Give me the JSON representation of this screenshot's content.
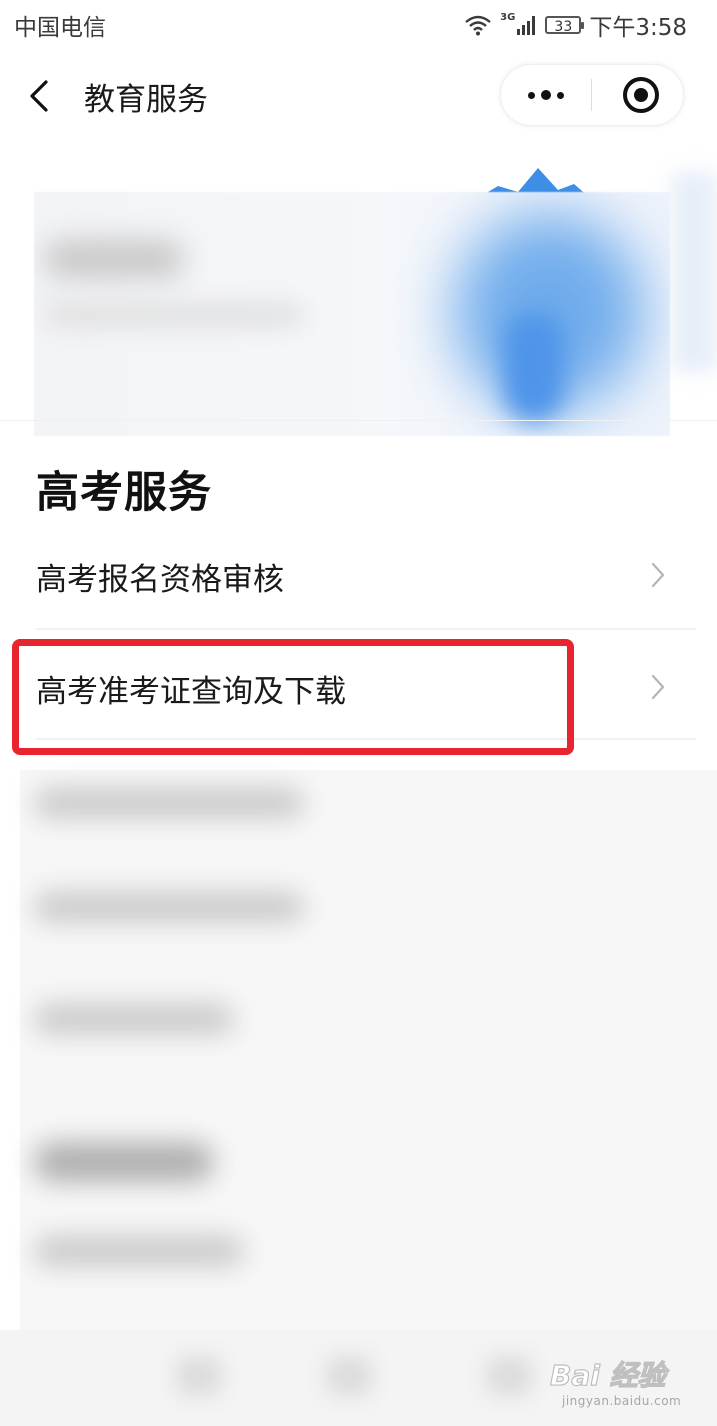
{
  "status_bar": {
    "carrier": "中国电信",
    "network": "3G",
    "battery": "33",
    "time": "下午3:58"
  },
  "nav": {
    "title": "教育服务",
    "back_icon": "chevron-left-icon",
    "more_icon": "more-dots-icon",
    "close_icon": "record-circle-icon"
  },
  "section": {
    "title": "高考服务",
    "items": [
      {
        "label": "高考报名资格审核",
        "icon": "chevron-right-icon"
      },
      {
        "label": "高考准考证查询及下载",
        "icon": "chevron-right-icon",
        "highlighted": true
      }
    ]
  },
  "colors": {
    "highlight": "#e8252f",
    "banner_accent": "#4e94e8"
  },
  "watermark": {
    "logo": "Bai 经验",
    "url": "jingyan.baidu.com"
  }
}
